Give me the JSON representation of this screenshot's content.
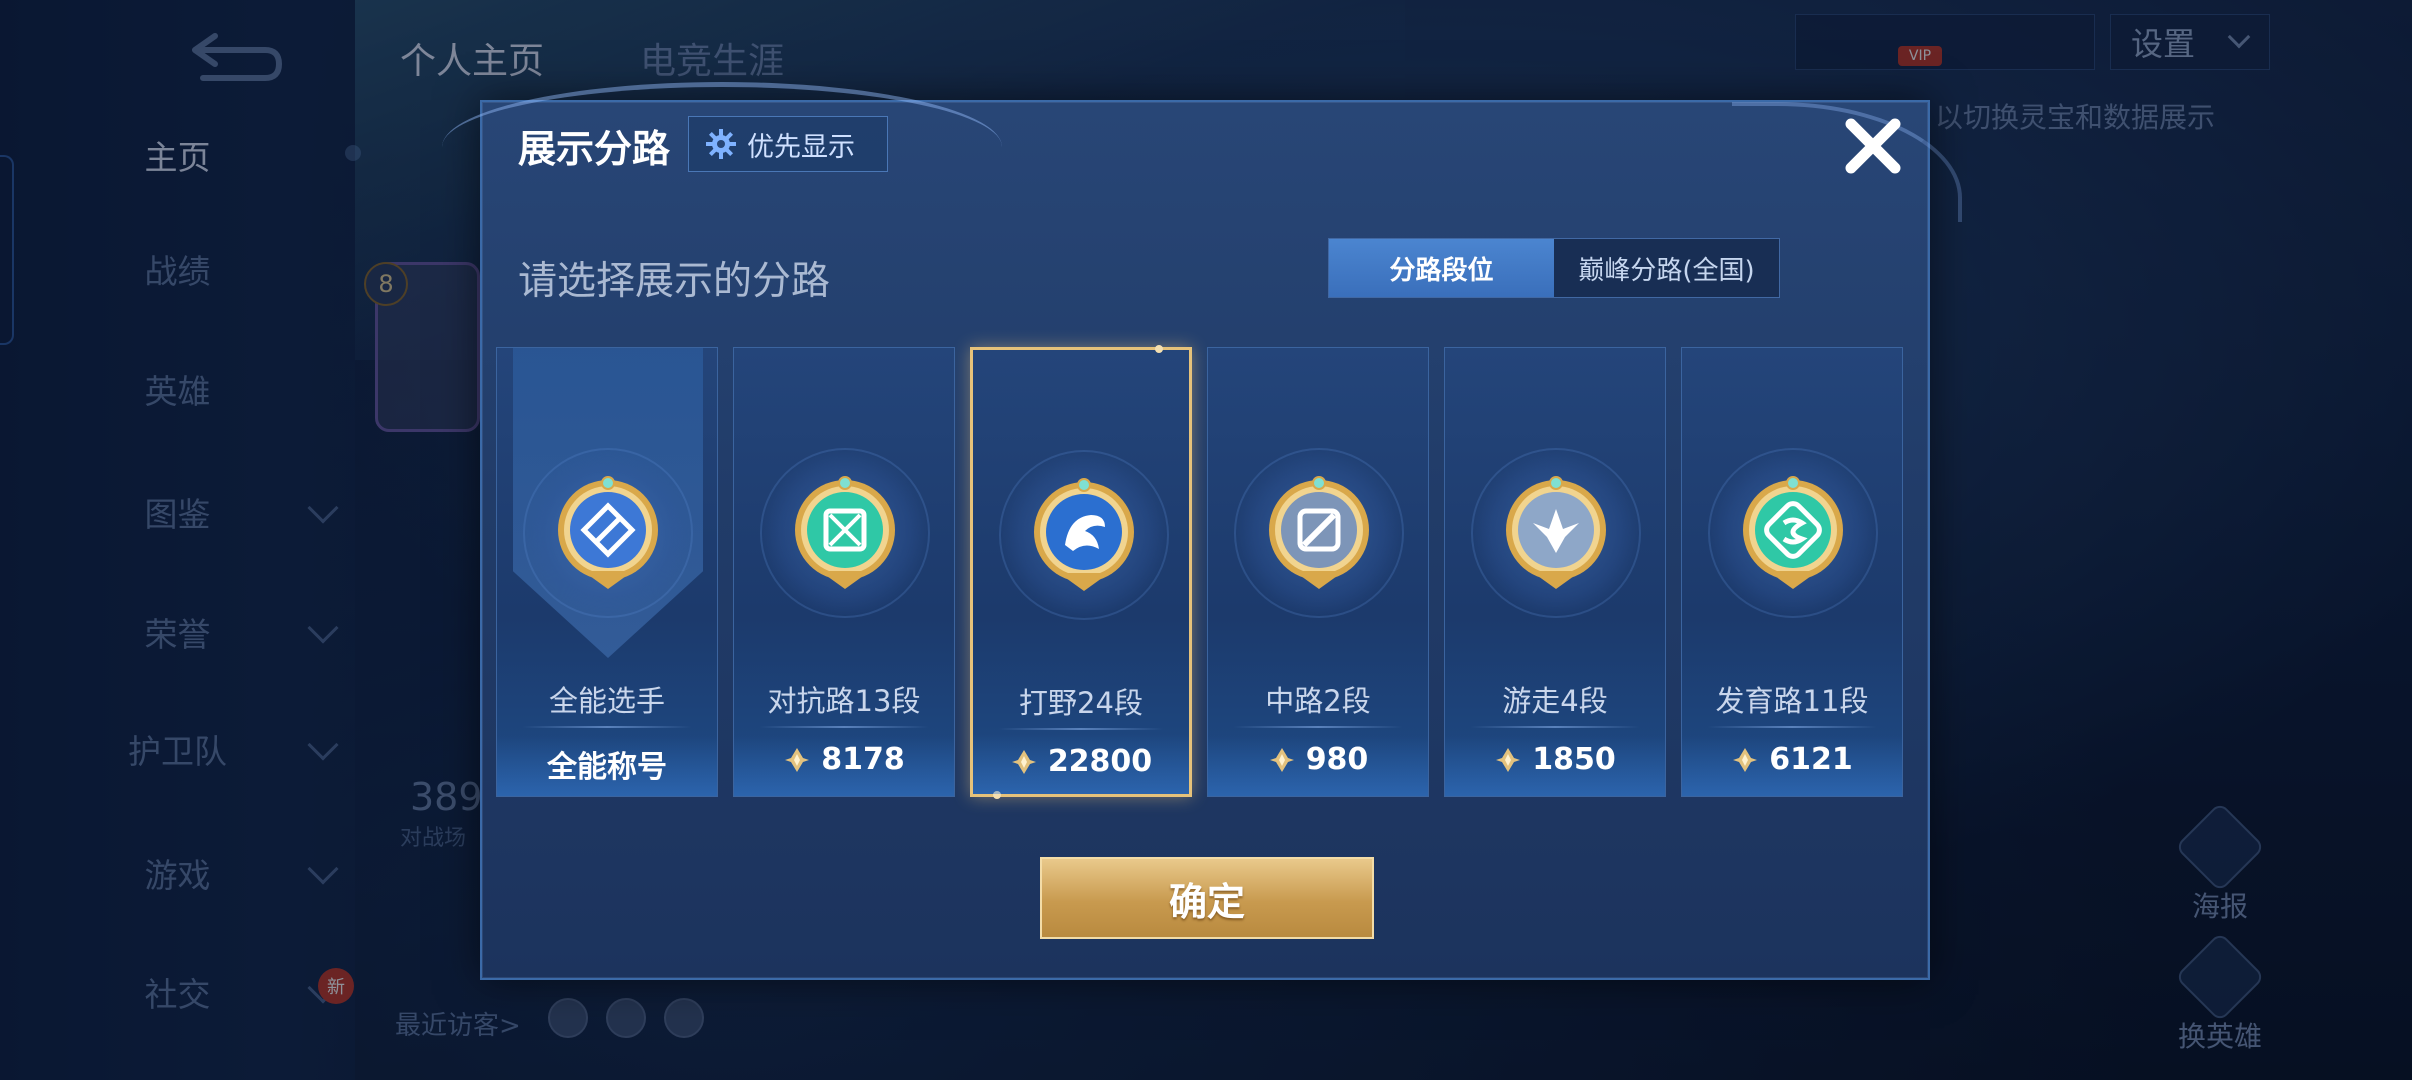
{
  "background": {
    "back_label": "",
    "top_tabs": [
      "个人主页",
      "电竞生涯"
    ],
    "nav_items": [
      {
        "label": "主页",
        "chevron": false,
        "active": true
      },
      {
        "label": "战绩",
        "chevron": false,
        "active": false
      },
      {
        "label": "英雄",
        "chevron": false,
        "active": false
      },
      {
        "label": "图鉴",
        "chevron": true,
        "active": false
      },
      {
        "label": "荣誉",
        "chevron": true,
        "active": false
      },
      {
        "label": "护卫队",
        "chevron": true,
        "active": false
      },
      {
        "label": "游戏",
        "chevron": true,
        "active": false
      },
      {
        "label": "社交",
        "chevron": true,
        "active": false
      }
    ],
    "new_badge": "新",
    "level": "8",
    "stat_value": "389",
    "stat_label": "对战场",
    "recent_visitors_label": "最近访客>",
    "vip_label": "VIP",
    "settings_label": "设置",
    "hint_text": "以切换灵宝和数据展示",
    "poster_label": "海报",
    "change_hero_label": "换英雄"
  },
  "modal": {
    "title": "展示分路",
    "priority_button": "优先显示",
    "subtitle": "请选择展示的分路",
    "segments": [
      {
        "label": "分路段位",
        "active": true
      },
      {
        "label": "巅峰分路(全国)",
        "active": false
      }
    ],
    "cards": [
      {
        "rank": "全能选手",
        "score": "全能称号",
        "has_coin": false,
        "selected": false,
        "emblem": "all-round-emblem-icon",
        "color": "#3d78d6"
      },
      {
        "rank": "对抗路13段",
        "score": "8178",
        "has_coin": true,
        "selected": false,
        "emblem": "clash-lane-emblem-icon",
        "color": "#2fc8a6"
      },
      {
        "rank": "打野24段",
        "score": "22800",
        "has_coin": true,
        "selected": true,
        "emblem": "jungle-emblem-icon",
        "color": "#2b6fd0"
      },
      {
        "rank": "中路2段",
        "score": "980",
        "has_coin": true,
        "selected": false,
        "emblem": "mid-lane-emblem-icon",
        "color": "#7d95b8"
      },
      {
        "rank": "游走4段",
        "score": "1850",
        "has_coin": true,
        "selected": false,
        "emblem": "roam-emblem-icon",
        "color": "#8ea7c8"
      },
      {
        "rank": "发育路11段",
        "score": "6121",
        "has_coin": true,
        "selected": false,
        "emblem": "farm-lane-emblem-icon",
        "color": "#2fc8a6"
      }
    ],
    "confirm_label": "确定",
    "accent_gold": "#e6c27a"
  }
}
